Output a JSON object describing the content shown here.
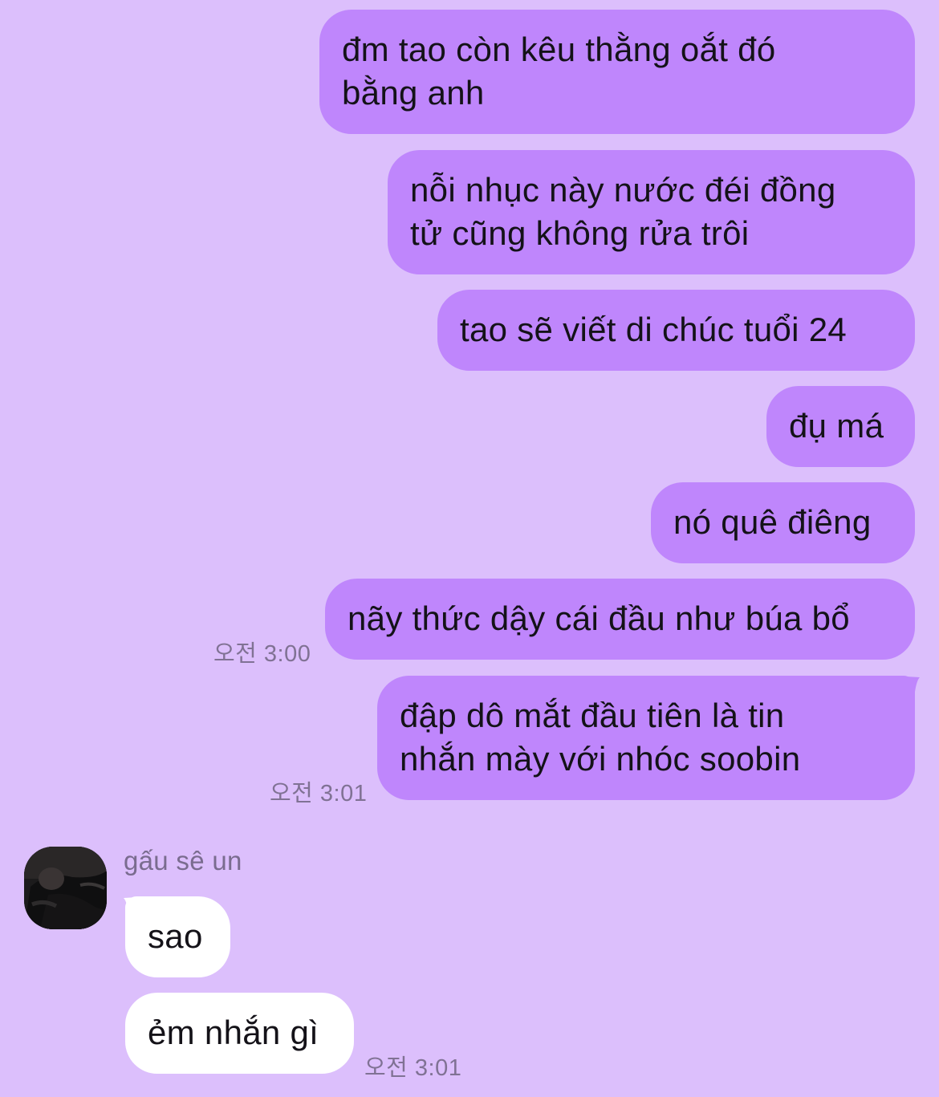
{
  "conversation": {
    "outgoing": [
      {
        "text": "đm tao còn kêu thằng oắt đó\nbằng anh"
      },
      {
        "text": "nỗi nhục này nước đéi đồng\ntử cũng không rửa trôi"
      },
      {
        "text": "tao sẽ viết di chúc tuổi 24"
      },
      {
        "text": "đụ má"
      },
      {
        "text": "nó quê điêng"
      },
      {
        "text": "nãy thức dậy cái đầu như búa bổ",
        "time": "오전 3:00"
      },
      {
        "text": "đập dô mắt đầu tiên là tin\nnhắn mày với nhóc soobin",
        "time": "오전 3:01"
      }
    ],
    "incoming": {
      "sender_name": "gấu sê un",
      "avatar_icon": "profile-photo",
      "messages": [
        {
          "text": "sao"
        },
        {
          "text": "ẻm nhắn gì",
          "time": "오전 3:01"
        }
      ]
    }
  },
  "colors": {
    "background": "#dcbffc",
    "outgoing_bubble": "#bf86fc",
    "incoming_bubble": "#ffffff",
    "timestamp": "#807294"
  }
}
